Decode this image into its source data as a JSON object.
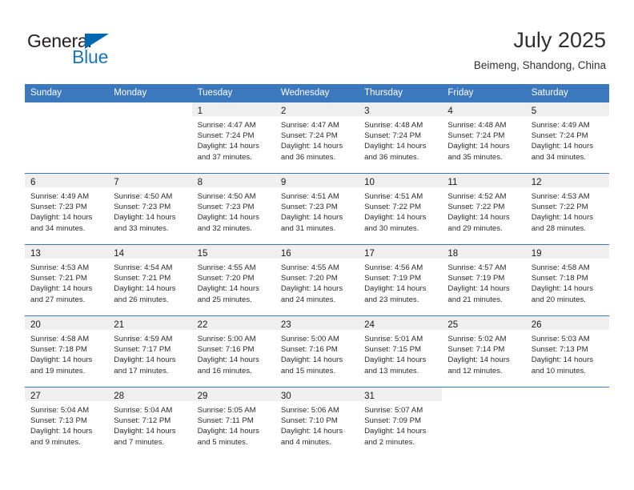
{
  "logo": {
    "word_one": "General",
    "word_two": "Blue",
    "triangle_icon": "triangle-icon",
    "accent_color": "#0067b1",
    "text_color": "#231f20"
  },
  "header": {
    "month_title": "July 2025",
    "location": "Beimeng, Shandong, China"
  },
  "calendar": {
    "header_bg": "#3b78be",
    "header_text_color": "#ffffff",
    "daynum_band_bg": "#efefef",
    "row_divider_color": "#3b78be",
    "weekdays": [
      "Sunday",
      "Monday",
      "Tuesday",
      "Wednesday",
      "Thursday",
      "Friday",
      "Saturday"
    ],
    "weeks": [
      [
        {
          "day": "",
          "sunrise": "",
          "sunset": "",
          "daylight_1": "",
          "daylight_2": ""
        },
        {
          "day": "",
          "sunrise": "",
          "sunset": "",
          "daylight_1": "",
          "daylight_2": ""
        },
        {
          "day": "1",
          "sunrise": "Sunrise: 4:47 AM",
          "sunset": "Sunset: 7:24 PM",
          "daylight_1": "Daylight: 14 hours",
          "daylight_2": "and 37 minutes."
        },
        {
          "day": "2",
          "sunrise": "Sunrise: 4:47 AM",
          "sunset": "Sunset: 7:24 PM",
          "daylight_1": "Daylight: 14 hours",
          "daylight_2": "and 36 minutes."
        },
        {
          "day": "3",
          "sunrise": "Sunrise: 4:48 AM",
          "sunset": "Sunset: 7:24 PM",
          "daylight_1": "Daylight: 14 hours",
          "daylight_2": "and 36 minutes."
        },
        {
          "day": "4",
          "sunrise": "Sunrise: 4:48 AM",
          "sunset": "Sunset: 7:24 PM",
          "daylight_1": "Daylight: 14 hours",
          "daylight_2": "and 35 minutes."
        },
        {
          "day": "5",
          "sunrise": "Sunrise: 4:49 AM",
          "sunset": "Sunset: 7:24 PM",
          "daylight_1": "Daylight: 14 hours",
          "daylight_2": "and 34 minutes."
        }
      ],
      [
        {
          "day": "6",
          "sunrise": "Sunrise: 4:49 AM",
          "sunset": "Sunset: 7:23 PM",
          "daylight_1": "Daylight: 14 hours",
          "daylight_2": "and 34 minutes."
        },
        {
          "day": "7",
          "sunrise": "Sunrise: 4:50 AM",
          "sunset": "Sunset: 7:23 PM",
          "daylight_1": "Daylight: 14 hours",
          "daylight_2": "and 33 minutes."
        },
        {
          "day": "8",
          "sunrise": "Sunrise: 4:50 AM",
          "sunset": "Sunset: 7:23 PM",
          "daylight_1": "Daylight: 14 hours",
          "daylight_2": "and 32 minutes."
        },
        {
          "day": "9",
          "sunrise": "Sunrise: 4:51 AM",
          "sunset": "Sunset: 7:23 PM",
          "daylight_1": "Daylight: 14 hours",
          "daylight_2": "and 31 minutes."
        },
        {
          "day": "10",
          "sunrise": "Sunrise: 4:51 AM",
          "sunset": "Sunset: 7:22 PM",
          "daylight_1": "Daylight: 14 hours",
          "daylight_2": "and 30 minutes."
        },
        {
          "day": "11",
          "sunrise": "Sunrise: 4:52 AM",
          "sunset": "Sunset: 7:22 PM",
          "daylight_1": "Daylight: 14 hours",
          "daylight_2": "and 29 minutes."
        },
        {
          "day": "12",
          "sunrise": "Sunrise: 4:53 AM",
          "sunset": "Sunset: 7:22 PM",
          "daylight_1": "Daylight: 14 hours",
          "daylight_2": "and 28 minutes."
        }
      ],
      [
        {
          "day": "13",
          "sunrise": "Sunrise: 4:53 AM",
          "sunset": "Sunset: 7:21 PM",
          "daylight_1": "Daylight: 14 hours",
          "daylight_2": "and 27 minutes."
        },
        {
          "day": "14",
          "sunrise": "Sunrise: 4:54 AM",
          "sunset": "Sunset: 7:21 PM",
          "daylight_1": "Daylight: 14 hours",
          "daylight_2": "and 26 minutes."
        },
        {
          "day": "15",
          "sunrise": "Sunrise: 4:55 AM",
          "sunset": "Sunset: 7:20 PM",
          "daylight_1": "Daylight: 14 hours",
          "daylight_2": "and 25 minutes."
        },
        {
          "day": "16",
          "sunrise": "Sunrise: 4:55 AM",
          "sunset": "Sunset: 7:20 PM",
          "daylight_1": "Daylight: 14 hours",
          "daylight_2": "and 24 minutes."
        },
        {
          "day": "17",
          "sunrise": "Sunrise: 4:56 AM",
          "sunset": "Sunset: 7:19 PM",
          "daylight_1": "Daylight: 14 hours",
          "daylight_2": "and 23 minutes."
        },
        {
          "day": "18",
          "sunrise": "Sunrise: 4:57 AM",
          "sunset": "Sunset: 7:19 PM",
          "daylight_1": "Daylight: 14 hours",
          "daylight_2": "and 21 minutes."
        },
        {
          "day": "19",
          "sunrise": "Sunrise: 4:58 AM",
          "sunset": "Sunset: 7:18 PM",
          "daylight_1": "Daylight: 14 hours",
          "daylight_2": "and 20 minutes."
        }
      ],
      [
        {
          "day": "20",
          "sunrise": "Sunrise: 4:58 AM",
          "sunset": "Sunset: 7:18 PM",
          "daylight_1": "Daylight: 14 hours",
          "daylight_2": "and 19 minutes."
        },
        {
          "day": "21",
          "sunrise": "Sunrise: 4:59 AM",
          "sunset": "Sunset: 7:17 PM",
          "daylight_1": "Daylight: 14 hours",
          "daylight_2": "and 17 minutes."
        },
        {
          "day": "22",
          "sunrise": "Sunrise: 5:00 AM",
          "sunset": "Sunset: 7:16 PM",
          "daylight_1": "Daylight: 14 hours",
          "daylight_2": "and 16 minutes."
        },
        {
          "day": "23",
          "sunrise": "Sunrise: 5:00 AM",
          "sunset": "Sunset: 7:16 PM",
          "daylight_1": "Daylight: 14 hours",
          "daylight_2": "and 15 minutes."
        },
        {
          "day": "24",
          "sunrise": "Sunrise: 5:01 AM",
          "sunset": "Sunset: 7:15 PM",
          "daylight_1": "Daylight: 14 hours",
          "daylight_2": "and 13 minutes."
        },
        {
          "day": "25",
          "sunrise": "Sunrise: 5:02 AM",
          "sunset": "Sunset: 7:14 PM",
          "daylight_1": "Daylight: 14 hours",
          "daylight_2": "and 12 minutes."
        },
        {
          "day": "26",
          "sunrise": "Sunrise: 5:03 AM",
          "sunset": "Sunset: 7:13 PM",
          "daylight_1": "Daylight: 14 hours",
          "daylight_2": "and 10 minutes."
        }
      ],
      [
        {
          "day": "27",
          "sunrise": "Sunrise: 5:04 AM",
          "sunset": "Sunset: 7:13 PM",
          "daylight_1": "Daylight: 14 hours",
          "daylight_2": "and 9 minutes."
        },
        {
          "day": "28",
          "sunrise": "Sunrise: 5:04 AM",
          "sunset": "Sunset: 7:12 PM",
          "daylight_1": "Daylight: 14 hours",
          "daylight_2": "and 7 minutes."
        },
        {
          "day": "29",
          "sunrise": "Sunrise: 5:05 AM",
          "sunset": "Sunset: 7:11 PM",
          "daylight_1": "Daylight: 14 hours",
          "daylight_2": "and 5 minutes."
        },
        {
          "day": "30",
          "sunrise": "Sunrise: 5:06 AM",
          "sunset": "Sunset: 7:10 PM",
          "daylight_1": "Daylight: 14 hours",
          "daylight_2": "and 4 minutes."
        },
        {
          "day": "31",
          "sunrise": "Sunrise: 5:07 AM",
          "sunset": "Sunset: 7:09 PM",
          "daylight_1": "Daylight: 14 hours",
          "daylight_2": "and 2 minutes."
        },
        {
          "day": "",
          "sunrise": "",
          "sunset": "",
          "daylight_1": "",
          "daylight_2": ""
        },
        {
          "day": "",
          "sunrise": "",
          "sunset": "",
          "daylight_1": "",
          "daylight_2": ""
        }
      ]
    ]
  }
}
